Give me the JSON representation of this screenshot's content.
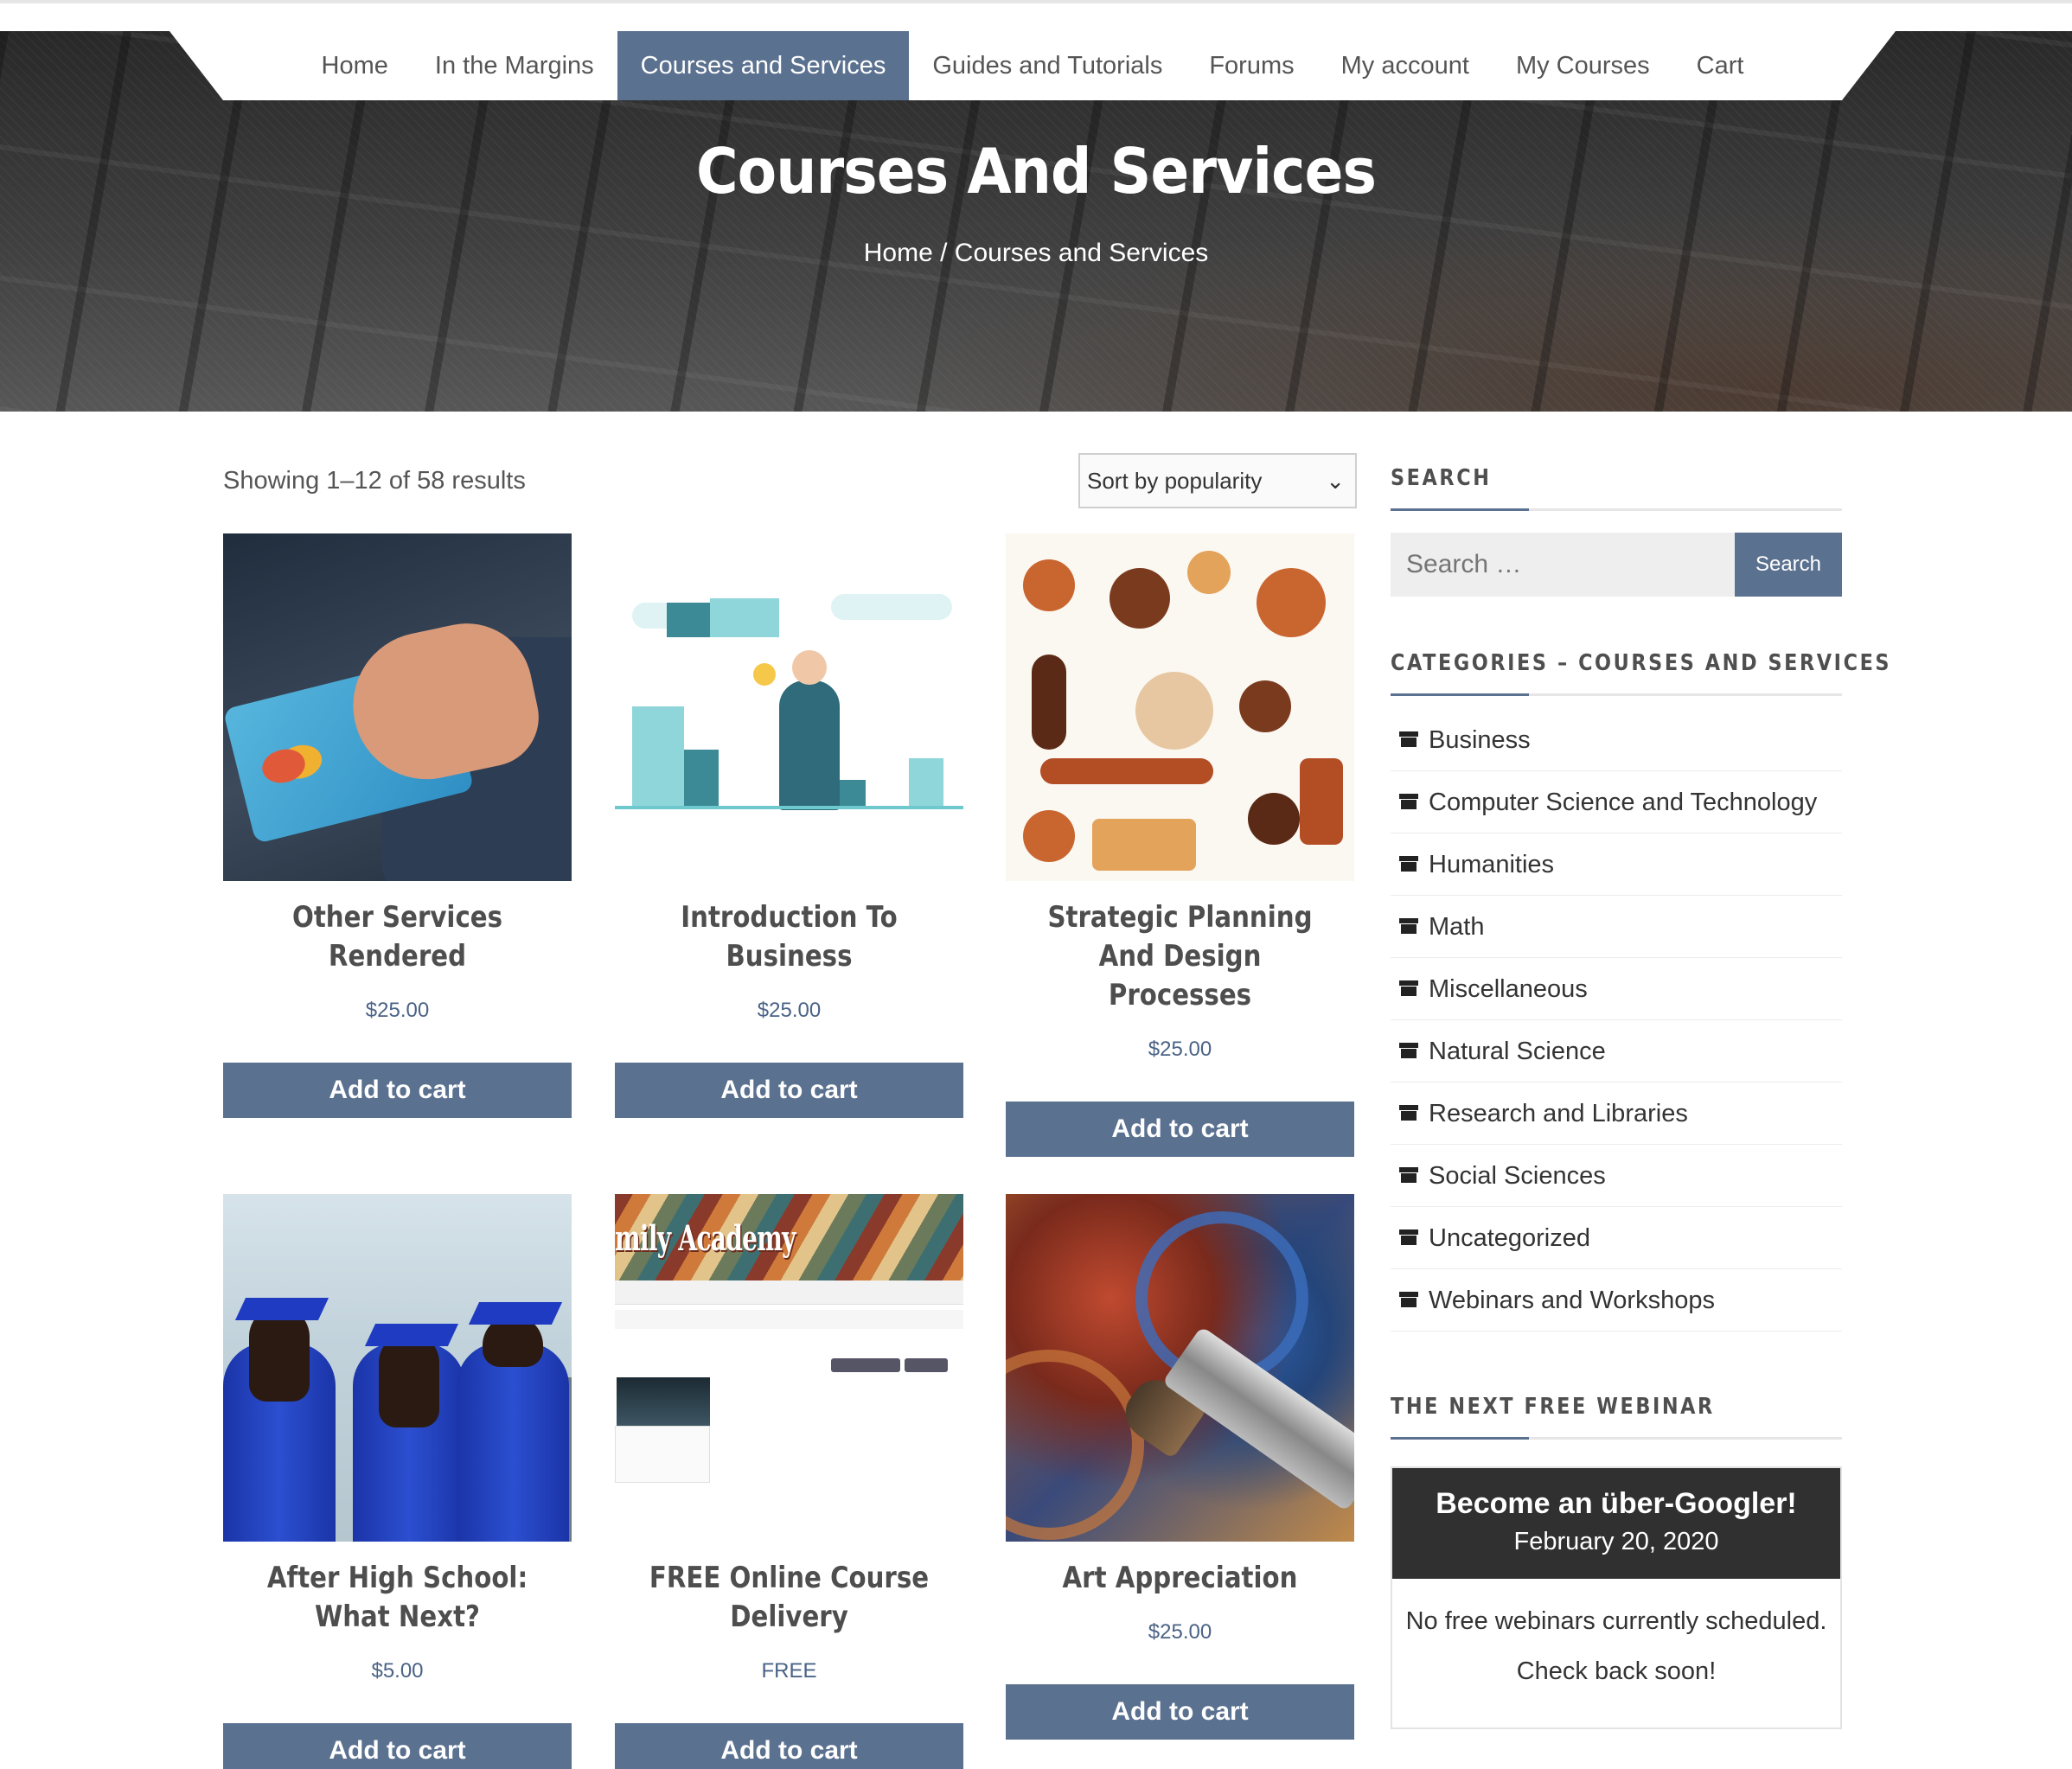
{
  "nav": {
    "items": [
      {
        "label": "Home",
        "active": false
      },
      {
        "label": "In the Margins",
        "active": false
      },
      {
        "label": "Courses and Services",
        "active": true
      },
      {
        "label": "Guides and Tutorials",
        "active": false
      },
      {
        "label": "Forums",
        "active": false
      },
      {
        "label": "My account",
        "active": false
      },
      {
        "label": "My Courses",
        "active": false
      },
      {
        "label": "Cart",
        "active": false
      }
    ]
  },
  "hero": {
    "title": "Courses And Services",
    "breadcrumb_home": "Home",
    "breadcrumb_sep": " / ",
    "breadcrumb_current": "Courses and Services"
  },
  "shop": {
    "result_count": "Showing 1–12 of 58 results",
    "sort_selected": "Sort by popularity",
    "add_to_cart_label": "Add to cart",
    "products": [
      {
        "title": "Other Services Rendered",
        "price": "$25.00"
      },
      {
        "title": "Introduction To Business",
        "price": "$25.00"
      },
      {
        "title": "Strategic Planning And Design Processes",
        "price": "$25.00"
      },
      {
        "title": "After High School: What Next?",
        "price": "$5.00"
      },
      {
        "title": "FREE Online Course Delivery",
        "price": "FREE"
      },
      {
        "title": "Art Appreciation",
        "price": "$25.00"
      }
    ],
    "thumb5_brand_text": "mily Academy"
  },
  "sidebar": {
    "search_heading": "SEARCH",
    "search_placeholder": "Search …",
    "search_button": "Search",
    "categories_heading": "CATEGORIES – COURSES AND SERVICES",
    "categories": [
      "Business",
      "Computer Science and Technology",
      "Humanities",
      "Math",
      "Miscellaneous",
      "Natural Science",
      "Research and Libraries",
      "Social Sciences",
      "Uncategorized",
      "Webinars and Workshops"
    ],
    "webinar_heading": "THE NEXT FREE WEBINAR",
    "webinar_title": "Become an über-Googler!",
    "webinar_date": "February 20, 2020",
    "webinar_message_1": "No free webinars currently scheduled.",
    "webinar_message_2": "Check back soon!"
  },
  "colors": {
    "accent": "#5b7190",
    "price": "#4a6386",
    "dark_panel": "#303030"
  }
}
